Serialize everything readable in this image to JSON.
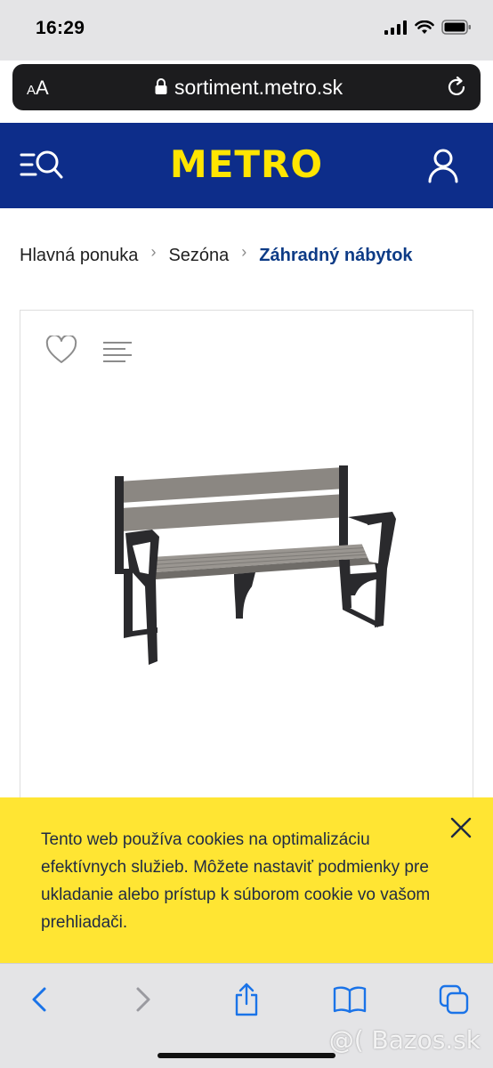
{
  "status_bar": {
    "time": "16:29"
  },
  "browser": {
    "text_size_label_small": "A",
    "text_size_label_large": "A",
    "url": "sortiment.metro.sk"
  },
  "header": {
    "logo": "METRO"
  },
  "breadcrumb": [
    {
      "label": "Hlavná ponuka"
    },
    {
      "label": "Sezóna"
    },
    {
      "label": "Záhradný nábytok"
    }
  ],
  "cookie_banner": {
    "text": "Tento web používa cookies na optimalizáciu efektívnych služieb. Môžete nastaviť podmienky pre ukladanie alebo prístup k súborom cookie vo vašom prehliadači."
  },
  "toolbar": {
    "items": [
      "back-icon",
      "forward-icon",
      "share-icon",
      "bookmarks-icon",
      "tabs-icon"
    ]
  },
  "watermark": "@( Bazos.sk",
  "colors": {
    "brand_blue": "#0d2d8a",
    "brand_yellow": "#ffe500",
    "cookie_yellow": "#ffe533",
    "breadcrumb_active": "#0d3b86"
  }
}
